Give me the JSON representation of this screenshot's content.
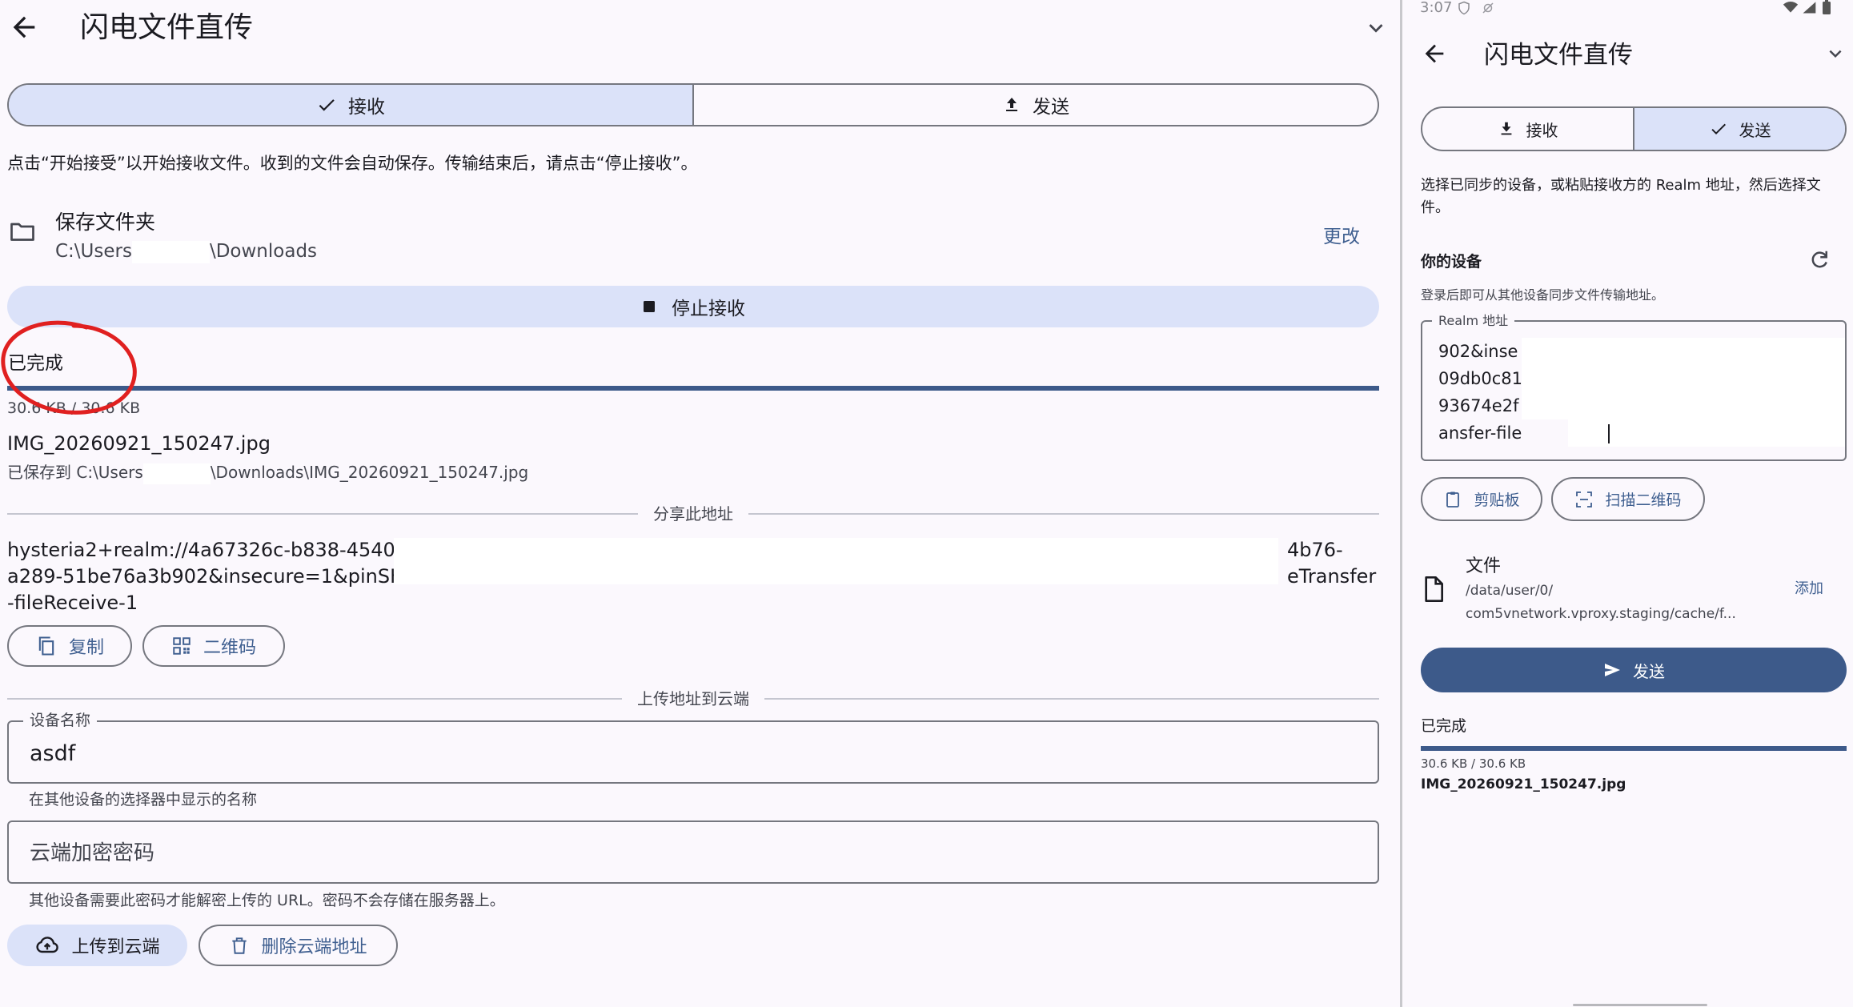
{
  "app_title": "闪电文件直传",
  "left": {
    "tabs": [
      {
        "label": "接收",
        "selected": true,
        "icon": "check-icon"
      },
      {
        "label": "发送",
        "selected": false,
        "icon": "upload-icon"
      }
    ],
    "instruction": "点击“开始接受”以开始接收文件。收到的文件会自动保存。传输结束后，请点击“停止接收”。",
    "save_folder": {
      "title": "保存文件夹",
      "path_prefix": "C:\\Users",
      "path_suffix": "\\Downloads",
      "change_label": "更改"
    },
    "stop_button_label": "停止接收",
    "status": "已完成",
    "progress": {
      "text": "30.6 KB / 30.6 KB",
      "fraction": 1.0
    },
    "file_name": "IMG_20260921_150247.jpg",
    "saved_prefix": "已保存到 C:\\Users",
    "saved_suffix": "\\Downloads\\IMG_20260921_150247.jpg",
    "share_header": "分享此地址",
    "share_lines": [
      {
        "left": "hysteria2+realm://4a67326c-b838-4540-a22",
        "right": "4b76-"
      },
      {
        "left": "a289-51be76a3b902&insecure=1&pinSHA25",
        "right": "eTransfer"
      },
      {
        "left": "-fileReceive-1",
        "right": ""
      }
    ],
    "copy_label": "复制",
    "qr_label": "二维码",
    "upload_header": "上传地址到云端",
    "device_name_label": "设备名称",
    "device_name_value": "asdf",
    "device_name_hint": "在其他设备的选择器中显示的名称",
    "password_placeholder": "云端加密密码",
    "password_hint": "其他设备需要此密码才能解密上传的 URL。密码不会存储在服务器上。",
    "upload_button": "上传到云端",
    "delete_button": "删除云端地址"
  },
  "right": {
    "status_time": "3:07",
    "tabs": [
      {
        "label": "接收",
        "selected": false,
        "icon": "download-icon"
      },
      {
        "label": "发送",
        "selected": true,
        "icon": "check-icon"
      }
    ],
    "instruction": "选择已同步的设备，或粘贴接收方的 Realm 地址，然后选择文件。",
    "devices_title": "你的设备",
    "devices_hint": "登录后即可从其他设备同步文件传输地址。",
    "realm_label": "Realm 地址",
    "realm_lines": [
      "902&inse",
      "09db0c81",
      "93674e2f",
      "ansfer-file"
    ],
    "clipboard_label": "剪贴板",
    "scan_label": "扫描二维码",
    "file_title": "文件",
    "file_path_1": "/data/user/0/",
    "file_path_2": "com5vnetwork.vproxy.staging/cache/f...",
    "add_label": "添加",
    "send_button": "发送",
    "status": "已完成",
    "progress": {
      "text": "30.6 KB / 30.6 KB",
      "fraction": 1.0
    },
    "file_name": "IMG_20260921_150247.jpg"
  },
  "colors": {
    "accent": "#3f5f90",
    "selected_bg": "#dbe2f9",
    "button_dark": "#3d5a8a",
    "annotation_red": "#e02020"
  }
}
